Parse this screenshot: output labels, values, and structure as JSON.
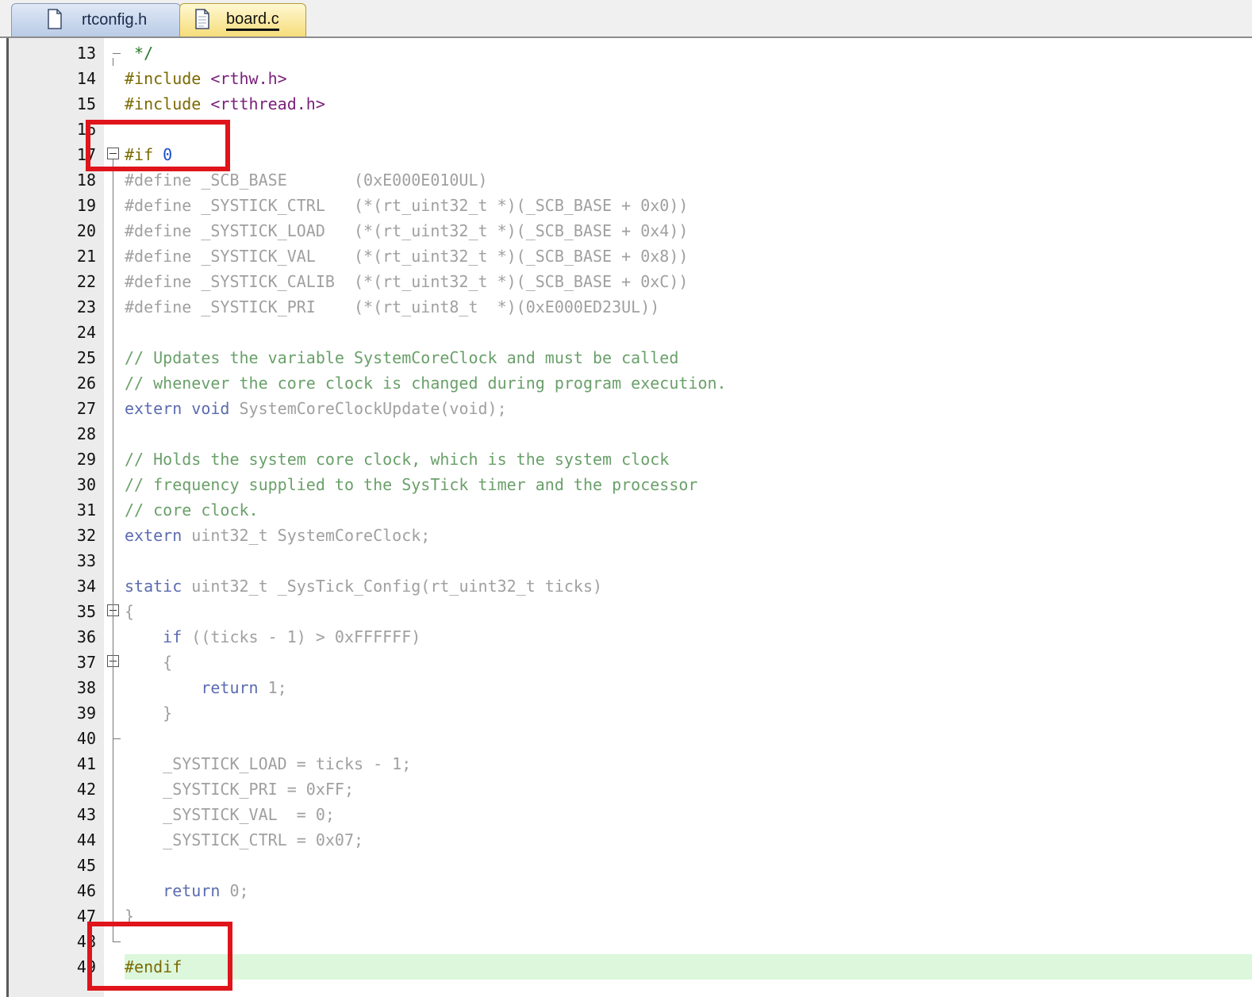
{
  "tabs": [
    {
      "label": "rtconfig.h",
      "active": false
    },
    {
      "label": "board.c",
      "active": true
    }
  ],
  "colors": {
    "highlight_box": "#e0141b",
    "current_line": "#dcf7dc",
    "active_tab": "#f6dd7a",
    "inactive_tab": "#b9cbe6"
  },
  "editor": {
    "lines": [
      {
        "num": "13",
        "text": " */"
      },
      {
        "num": "14",
        "text": "#include <rthw.h>"
      },
      {
        "num": "15",
        "text": "#include <rtthread.h>"
      },
      {
        "num": "16",
        "text": ""
      },
      {
        "num": "17",
        "text": "#if 0"
      },
      {
        "num": "18",
        "text": "#define _SCB_BASE       (0xE000E010UL)"
      },
      {
        "num": "19",
        "text": "#define _SYSTICK_CTRL   (*(rt_uint32_t *)(_SCB_BASE + 0x0))"
      },
      {
        "num": "20",
        "text": "#define _SYSTICK_LOAD   (*(rt_uint32_t *)(_SCB_BASE + 0x4))"
      },
      {
        "num": "21",
        "text": "#define _SYSTICK_VAL    (*(rt_uint32_t *)(_SCB_BASE + 0x8))"
      },
      {
        "num": "22",
        "text": "#define _SYSTICK_CALIB  (*(rt_uint32_t *)(_SCB_BASE + 0xC))"
      },
      {
        "num": "23",
        "text": "#define _SYSTICK_PRI    (*(rt_uint8_t  *)(0xE000ED23UL))"
      },
      {
        "num": "24",
        "text": ""
      },
      {
        "num": "25",
        "text": "// Updates the variable SystemCoreClock and must be called"
      },
      {
        "num": "26",
        "text": "// whenever the core clock is changed during program execution."
      },
      {
        "num": "27",
        "text": "extern void SystemCoreClockUpdate(void);"
      },
      {
        "num": "28",
        "text": ""
      },
      {
        "num": "29",
        "text": "// Holds the system core clock, which is the system clock"
      },
      {
        "num": "30",
        "text": "// frequency supplied to the SysTick timer and the processor"
      },
      {
        "num": "31",
        "text": "// core clock."
      },
      {
        "num": "32",
        "text": "extern uint32_t SystemCoreClock;"
      },
      {
        "num": "33",
        "text": ""
      },
      {
        "num": "34",
        "text": "static uint32_t _SysTick_Config(rt_uint32_t ticks)"
      },
      {
        "num": "35",
        "text": "{"
      },
      {
        "num": "36",
        "text": "    if ((ticks - 1) > 0xFFFFFF)"
      },
      {
        "num": "37",
        "text": "    {"
      },
      {
        "num": "38",
        "text": "        return 1;"
      },
      {
        "num": "39",
        "text": "    }"
      },
      {
        "num": "40",
        "text": ""
      },
      {
        "num": "41",
        "text": "    _SYSTICK_LOAD = ticks - 1;"
      },
      {
        "num": "42",
        "text": "    _SYSTICK_PRI = 0xFF;"
      },
      {
        "num": "43",
        "text": "    _SYSTICK_VAL  = 0;"
      },
      {
        "num": "44",
        "text": "    _SYSTICK_CTRL = 0x07;"
      },
      {
        "num": "45",
        "text": ""
      },
      {
        "num": "46",
        "text": "    return 0;"
      },
      {
        "num": "47",
        "text": "}"
      },
      {
        "num": "48",
        "text": ""
      },
      {
        "num": "49",
        "text": "#endif"
      }
    ]
  }
}
